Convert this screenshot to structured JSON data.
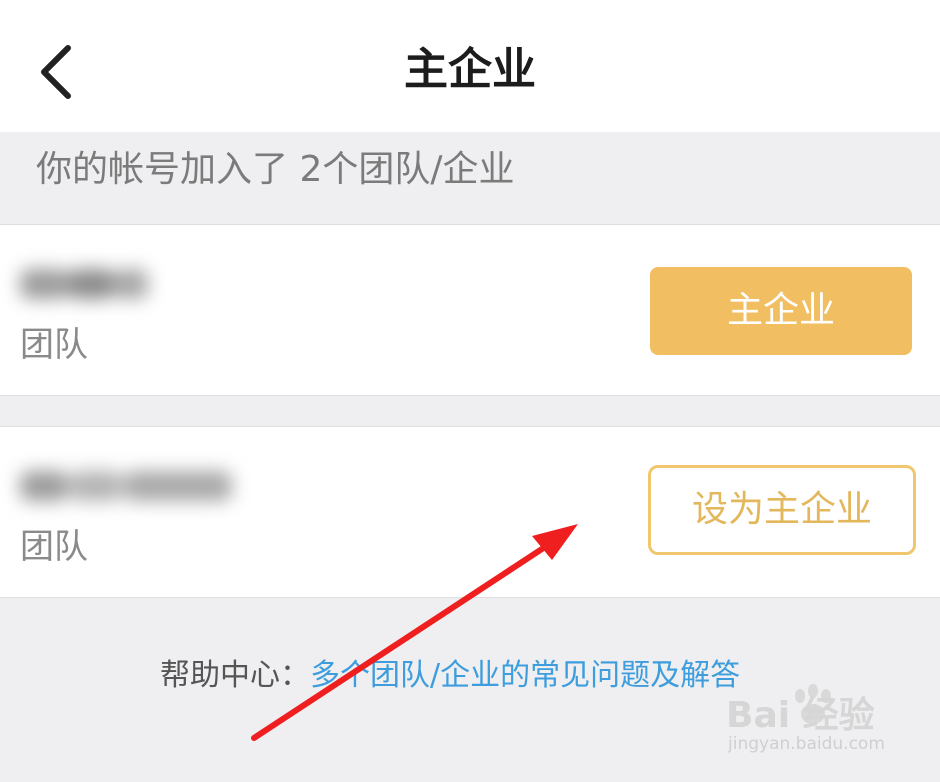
{
  "header": {
    "title": "主企业",
    "back_icon": "chevron-left-icon"
  },
  "section": {
    "summary": "你的帐号加入了 2个团队/企业"
  },
  "organizations": [
    {
      "type": "团队",
      "button_label": "主企业",
      "is_primary": true
    },
    {
      "type": "团队",
      "button_label": "设为主企业",
      "is_primary": false
    }
  ],
  "help": {
    "label": "帮助中心：",
    "link_text": "多个团队/企业的常见问题及解答"
  },
  "watermark": {
    "logo": "Bai 经验",
    "url": "jingyan.baidu.com"
  },
  "colors": {
    "accent": "#f1bf62",
    "link": "#3d9ddd",
    "annotation_arrow": "#f01f1f"
  }
}
